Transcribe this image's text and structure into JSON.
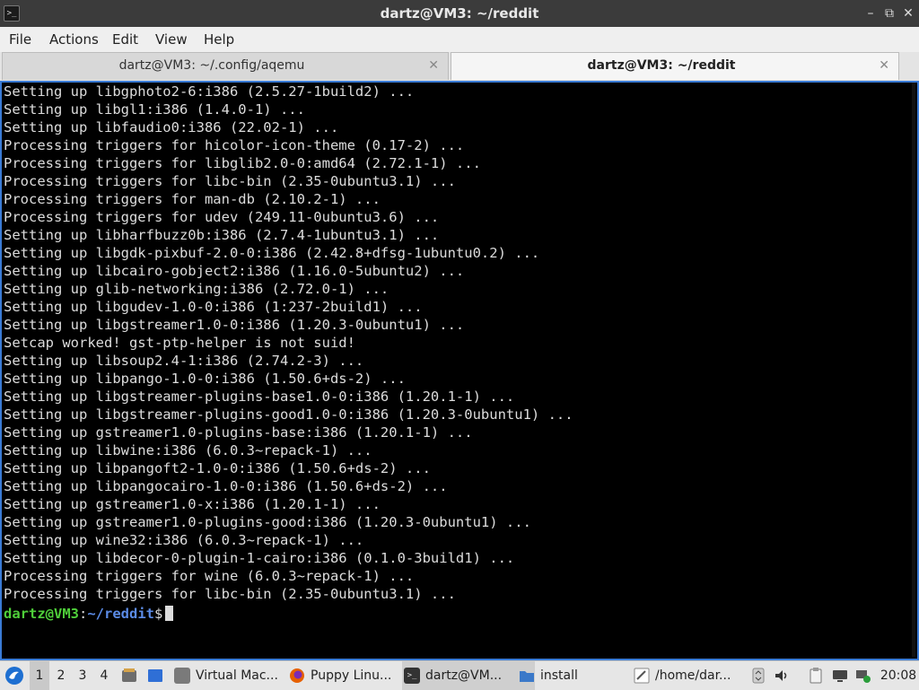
{
  "window": {
    "title": "dartz@VM3: ~/reddit",
    "app_icon": "terminal-icon",
    "minimize_label": "–",
    "maximize_label": "⧉",
    "close_label": "✕"
  },
  "menu": [
    "File",
    "Actions",
    "Edit",
    "View",
    "Help"
  ],
  "tabs": [
    {
      "label": "dartz@VM3: ~/.config/aqemu",
      "close": "✕",
      "active": false
    },
    {
      "label": "dartz@VM3: ~/reddit",
      "close": "✕",
      "active": true
    }
  ],
  "terminal": {
    "lines": [
      "Setting up libgphoto2-6:i386 (2.5.27-1build2) ...",
      "Setting up libgl1:i386 (1.4.0-1) ...",
      "Setting up libfaudio0:i386 (22.02-1) ...",
      "Processing triggers for hicolor-icon-theme (0.17-2) ...",
      "Processing triggers for libglib2.0-0:amd64 (2.72.1-1) ...",
      "Processing triggers for libc-bin (2.35-0ubuntu3.1) ...",
      "Processing triggers for man-db (2.10.2-1) ...",
      "Processing triggers for udev (249.11-0ubuntu3.6) ...",
      "Setting up libharfbuzz0b:i386 (2.7.4-1ubuntu3.1) ...",
      "Setting up libgdk-pixbuf-2.0-0:i386 (2.42.8+dfsg-1ubuntu0.2) ...",
      "Setting up libcairo-gobject2:i386 (1.16.0-5ubuntu2) ...",
      "Setting up glib-networking:i386 (2.72.0-1) ...",
      "Setting up libgudev-1.0-0:i386 (1:237-2build1) ...",
      "Setting up libgstreamer1.0-0:i386 (1.20.3-0ubuntu1) ...",
      "Setcap worked! gst-ptp-helper is not suid!",
      "Setting up libsoup2.4-1:i386 (2.74.2-3) ...",
      "Setting up libpango-1.0-0:i386 (1.50.6+ds-2) ...",
      "Setting up libgstreamer-plugins-base1.0-0:i386 (1.20.1-1) ...",
      "Setting up libgstreamer-plugins-good1.0-0:i386 (1.20.3-0ubuntu1) ...",
      "Setting up gstreamer1.0-plugins-base:i386 (1.20.1-1) ...",
      "Setting up libwine:i386 (6.0.3~repack-1) ...",
      "Setting up libpangoft2-1.0-0:i386 (1.50.6+ds-2) ...",
      "Setting up libpangocairo-1.0-0:i386 (1.50.6+ds-2) ...",
      "Setting up gstreamer1.0-x:i386 (1.20.1-1) ...",
      "Setting up gstreamer1.0-plugins-good:i386 (1.20.3-0ubuntu1) ...",
      "Setting up wine32:i386 (6.0.3~repack-1) ...",
      "Setting up libdecor-0-plugin-1-cairo:i386 (0.1.0-3build1) ...",
      "Processing triggers for wine (6.0.3~repack-1) ...",
      "Processing triggers for libc-bin (2.35-0ubuntu3.1) ..."
    ],
    "prompt": {
      "user_host": "dartz@VM3",
      "separator": ":",
      "path": "~/reddit",
      "symbol": "$"
    }
  },
  "taskbar": {
    "start_icon": "lubuntu-start-icon",
    "workspaces": [
      "1",
      "2",
      "3",
      "4"
    ],
    "active_workspace": "1",
    "tasks": [
      {
        "label": "Virtual Mac...",
        "icon": "virtualbox-icon",
        "color": "#7a7a7a"
      },
      {
        "label": "Puppy Linu...",
        "icon": "firefox-icon",
        "color": "#e66000"
      },
      {
        "label": "dartz@VM...",
        "icon": "terminal-icon",
        "color": "#333333"
      },
      {
        "label": "install",
        "icon": "folder-icon",
        "color": "#3b79c9"
      },
      {
        "label": "/home/dar...",
        "icon": "text-editor-icon",
        "color": "#9a9a9a"
      }
    ],
    "clock": "20:08"
  }
}
